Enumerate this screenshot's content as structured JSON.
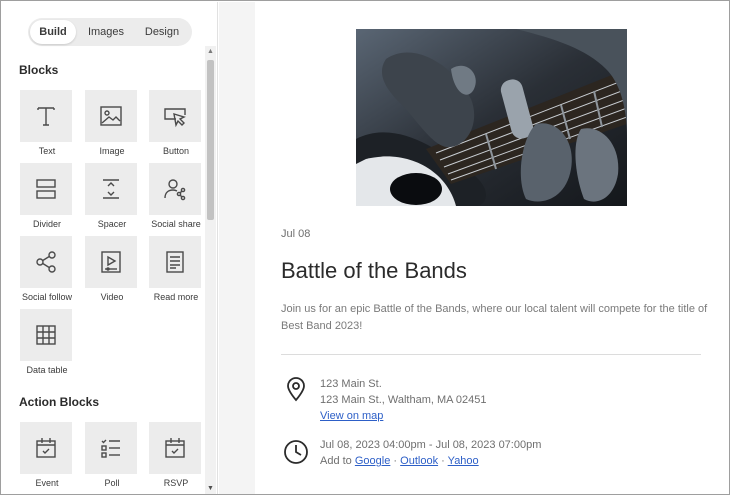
{
  "tabs": [
    "Build",
    "Images",
    "Design"
  ],
  "blocks_title": "Blocks",
  "blocks": [
    {
      "label": "Text",
      "icon": "text-icon"
    },
    {
      "label": "Image",
      "icon": "image-icon"
    },
    {
      "label": "Button",
      "icon": "button-icon"
    },
    {
      "label": "Divider",
      "icon": "divider-icon"
    },
    {
      "label": "Spacer",
      "icon": "spacer-icon"
    },
    {
      "label": "Social share",
      "icon": "social-share-icon"
    },
    {
      "label": "Social follow",
      "icon": "social-follow-icon"
    },
    {
      "label": "Video",
      "icon": "video-icon"
    },
    {
      "label": "Read more",
      "icon": "read-more-icon"
    },
    {
      "label": "Data table",
      "icon": "data-table-icon"
    }
  ],
  "action_blocks_title": "Action Blocks",
  "action_blocks": [
    {
      "label": "Event",
      "icon": "calendar-event-icon"
    },
    {
      "label": "Poll",
      "icon": "poll-icon"
    },
    {
      "label": "RSVP",
      "icon": "calendar-rsvp-icon"
    }
  ],
  "preview": {
    "date": "Jul 08",
    "title": "Battle of the Bands",
    "description": "Join us for an epic Battle of the Bands, where our local talent will compete for the title of Best Band 2023!",
    "address_line1": "123 Main St.",
    "address_line2": "123 Main St., Waltham, MA 02451",
    "map_link": "View on map",
    "datetime": "Jul 08, 2023 04:00pm - Jul 08, 2023 07:00pm",
    "add_to_label": "Add to",
    "calendar_links": [
      "Google",
      "Outlook",
      "Yahoo"
    ],
    "separator": "·"
  },
  "colors": {
    "link": "#2d5fc7",
    "tile": "#ececec"
  }
}
